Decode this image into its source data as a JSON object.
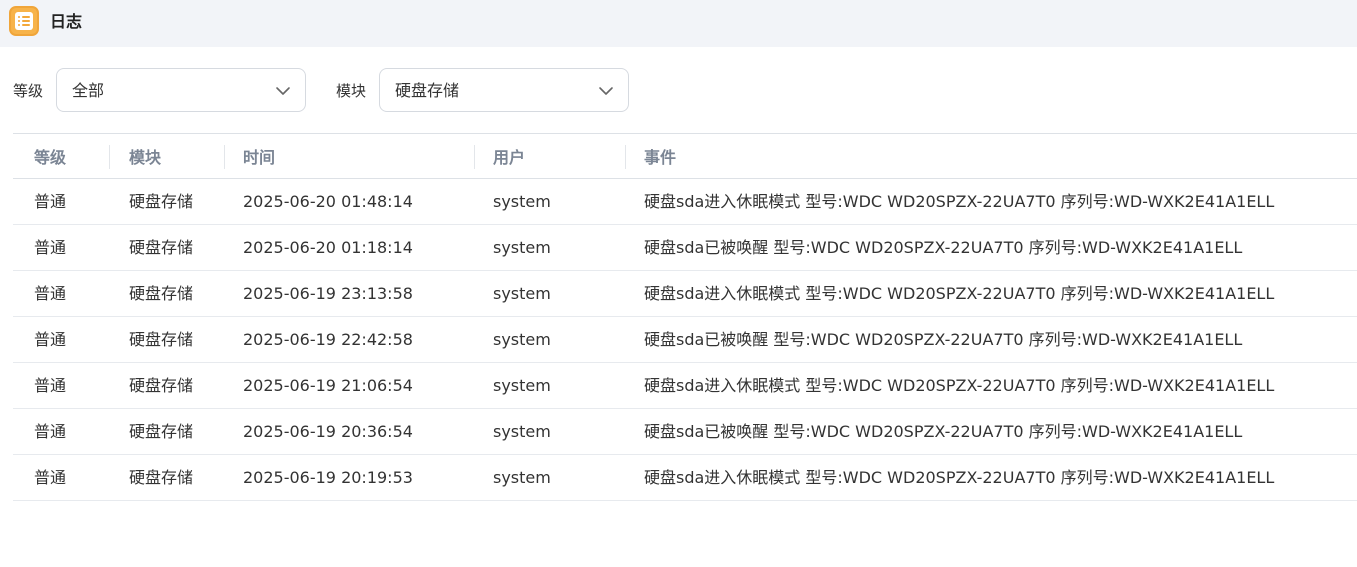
{
  "app": {
    "title": "日志",
    "icon": "log-list-icon"
  },
  "filters": {
    "level_label": "等级",
    "level_value": "全部",
    "module_label": "模块",
    "module_value": "硬盘存储"
  },
  "table": {
    "headers": [
      "等级",
      "模块",
      "时间",
      "用户",
      "事件"
    ],
    "rows": [
      {
        "level": "普通",
        "module": "硬盘存储",
        "time": "2025-06-20 01:48:14",
        "user": "system",
        "event": "硬盘sda进入休眠模式 型号:WDC WD20SPZX-22UA7T0 序列号:WD-WXK2E41A1ELL"
      },
      {
        "level": "普通",
        "module": "硬盘存储",
        "time": "2025-06-20 01:18:14",
        "user": "system",
        "event": "硬盘sda已被唤醒 型号:WDC WD20SPZX-22UA7T0 序列号:WD-WXK2E41A1ELL"
      },
      {
        "level": "普通",
        "module": "硬盘存储",
        "time": "2025-06-19 23:13:58",
        "user": "system",
        "event": "硬盘sda进入休眠模式 型号:WDC WD20SPZX-22UA7T0 序列号:WD-WXK2E41A1ELL"
      },
      {
        "level": "普通",
        "module": "硬盘存储",
        "time": "2025-06-19 22:42:58",
        "user": "system",
        "event": "硬盘sda已被唤醒 型号:WDC WD20SPZX-22UA7T0 序列号:WD-WXK2E41A1ELL"
      },
      {
        "level": "普通",
        "module": "硬盘存储",
        "time": "2025-06-19 21:06:54",
        "user": "system",
        "event": "硬盘sda进入休眠模式 型号:WDC WD20SPZX-22UA7T0 序列号:WD-WXK2E41A1ELL"
      },
      {
        "level": "普通",
        "module": "硬盘存储",
        "time": "2025-06-19 20:36:54",
        "user": "system",
        "event": "硬盘sda已被唤醒 型号:WDC WD20SPZX-22UA7T0 序列号:WD-WXK2E41A1ELL"
      },
      {
        "level": "普通",
        "module": "硬盘存储",
        "time": "2025-06-19 20:19:53",
        "user": "system",
        "event": "硬盘sda进入休眠模式 型号:WDC WD20SPZX-22UA7T0 序列号:WD-WXK2E41A1ELL"
      }
    ]
  },
  "colors": {
    "titlebar_bg": "#f2f4f8",
    "icon_accent": "#f7b34a",
    "header_text": "#7b8594"
  }
}
